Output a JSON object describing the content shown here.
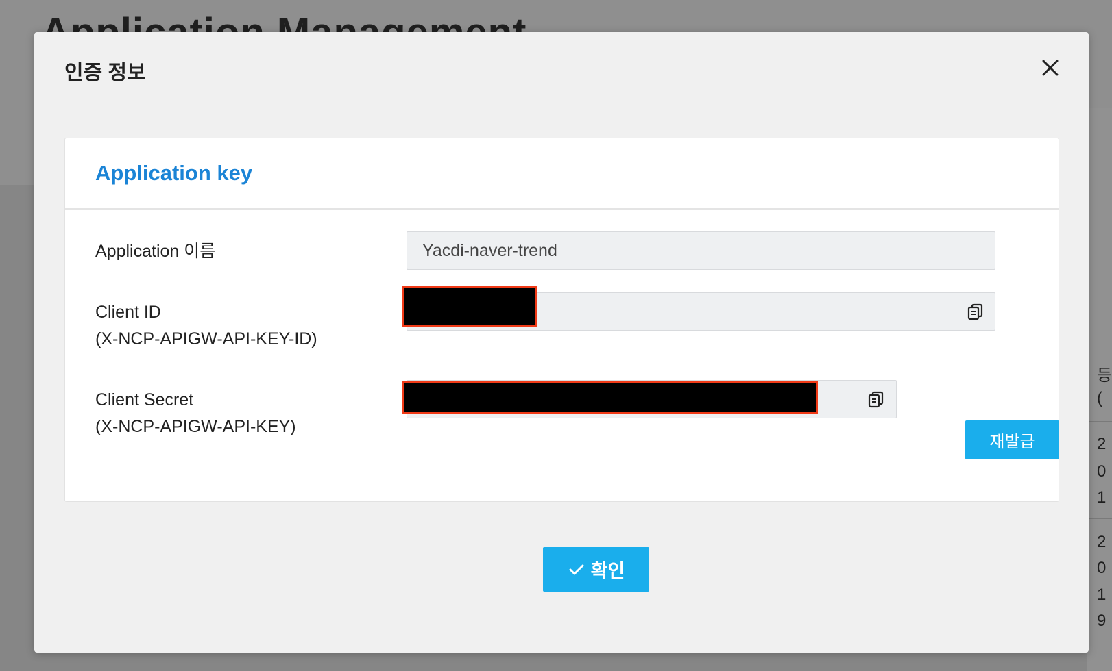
{
  "background": {
    "page_title": "Application Management",
    "right_column_cells": [
      "등",
      "(",
      "2",
      "0",
      "1",
      "2",
      "0",
      "1",
      "9"
    ]
  },
  "modal": {
    "title": "인증 정보",
    "close_icon": "close-icon",
    "card": {
      "title": "Application key",
      "rows": {
        "app_name": {
          "label": "Application 이름",
          "value": "Yacdi-naver-trend"
        },
        "client_id": {
          "label_line1": "Client ID",
          "label_line2": "(X-NCP-APIGW-API-KEY-ID)",
          "copy_icon": "copy-icon"
        },
        "client_secret": {
          "label_line1": "Client Secret",
          "label_line2": "(X-NCP-APIGW-API-KEY)",
          "copy_icon": "copy-icon",
          "reissue_label": "재발급"
        }
      }
    },
    "confirm_label": "확인",
    "confirm_icon": "check-icon"
  },
  "colors": {
    "accent_blue": "#1aaeec",
    "title_blue": "#1b84d6",
    "redaction_border": "#f03a17"
  }
}
